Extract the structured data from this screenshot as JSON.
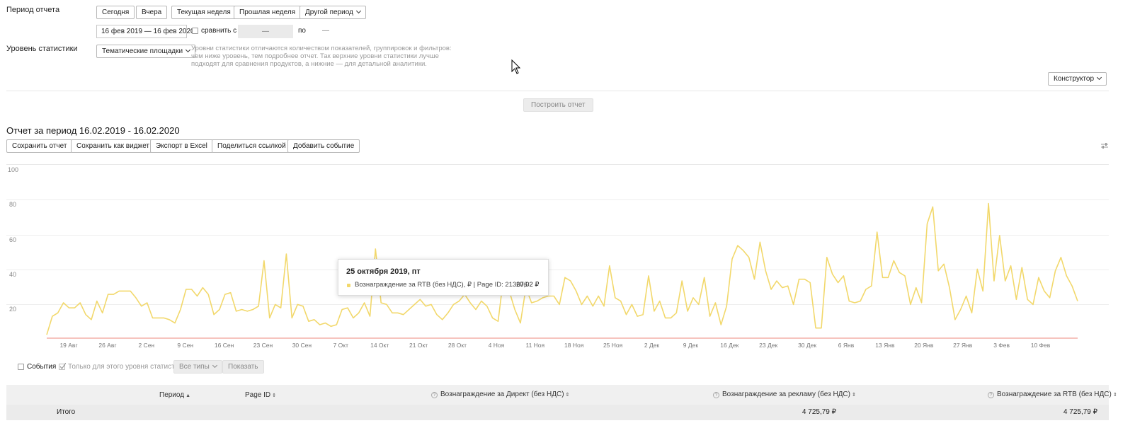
{
  "filters": {
    "period_label": "Период отчета",
    "quick_periods": [
      "Сегодня",
      "Вчера",
      "Текущая неделя",
      "Прошлая неделя",
      "Другой период"
    ],
    "date_range": "16 фев 2019 — 16 фев 2020",
    "compare_label": "сравнить с",
    "compare_from": "—",
    "compare_to_label": "по",
    "compare_to": "—",
    "level_label": "Уровень статистики",
    "level_value": "Тематические площадки",
    "level_hint": "Уровни статистики отличаются количеством показателей, группировок и фильтров: чем ниже уровень, тем подробнее отчет. Так верхние уровни статистики лучше подходят для сравнения продуктов, а нижние — для детальной аналитики.",
    "constructor_label": "Конструктор",
    "build_label": "Построить отчет"
  },
  "report": {
    "title": "Отчет за период 16.02.2019 - 16.02.2020",
    "actions": [
      "Сохранить отчет",
      "Сохранить как виджет",
      "Экспорт в Excel",
      "Поделиться ссылкой",
      "Добавить событие"
    ]
  },
  "tooltip": {
    "date": "25 октября 2019, пт",
    "series": "Вознаграждение за RTB (без НДС), ₽ | Page ID: 213676",
    "value": "20,02 ₽"
  },
  "events": {
    "events_label": "События",
    "only_level_label": "Только для этого уровня статистики",
    "all_types_label": "Все типы",
    "show_label": "Показать"
  },
  "table": {
    "headers": [
      "Период",
      "Page ID",
      "Вознаграждение за Директ (без НДС)",
      "Вознаграждение за рекламу (без НДС)",
      "Вознаграждение за RTB (без НДС)"
    ],
    "total_label": "Итого",
    "total_direct": "",
    "total_ads": "4 725,79 ₽",
    "total_rtb": "4 725,79 ₽"
  },
  "colors": {
    "series": "#f2d86b",
    "zero_line": "#f3b0a8",
    "accent": "#e0c050"
  },
  "chart_data": {
    "type": "line",
    "yticks": [
      "100",
      "80",
      "60",
      "40",
      "20"
    ],
    "ylim": [
      0,
      100
    ],
    "xticks": [
      "19 Авг",
      "26 Авг",
      "2 Сен",
      "9 Сен",
      "16 Сен",
      "23 Сен",
      "30 Сен",
      "7 Окт",
      "14 Окт",
      "21 Окт",
      "28 Окт",
      "4 Ноя",
      "11 Ноя",
      "18 Ноя",
      "25 Ноя",
      "2 Дек",
      "9 Дек",
      "16 Дек",
      "23 Дек",
      "30 Дек",
      "6 Янв",
      "13 Янв",
      "20 Янв",
      "27 Янв",
      "3 Фев",
      "10 Фев"
    ],
    "series": [
      {
        "name": "Вознаграждение за RTB (без НДС), ₽ | Page ID: 213676",
        "values": [
          2,
          13,
          15,
          21,
          18,
          18,
          21,
          14,
          11,
          22,
          15,
          26,
          26,
          28,
          28,
          28,
          24,
          19,
          21,
          12,
          12,
          12,
          11,
          9,
          17,
          29,
          29,
          25,
          30,
          26,
          14,
          17,
          26,
          27,
          16,
          17,
          16,
          17,
          19,
          46,
          12,
          20,
          18,
          50,
          12,
          20,
          19,
          10,
          11,
          8,
          9,
          7,
          8,
          17,
          18,
          12,
          15,
          21,
          13,
          53,
          21,
          20,
          15,
          15,
          14,
          17,
          20,
          23,
          19,
          20,
          14,
          11,
          15,
          20,
          22,
          26,
          21,
          17,
          22,
          19,
          12,
          10,
          37,
          28,
          17,
          9,
          30,
          21,
          22,
          24,
          25,
          25,
          20,
          36,
          34,
          28,
          20,
          25,
          19,
          25,
          19,
          43,
          24,
          22,
          14,
          20,
          13,
          14,
          37,
          16,
          22,
          12,
          12,
          15,
          34,
          16,
          24,
          20,
          36,
          13,
          21,
          8,
          19,
          47,
          55,
          52,
          48,
          35,
          57,
          40,
          29,
          34,
          30,
          31,
          20,
          35,
          35,
          33,
          6,
          6,
          48,
          38,
          33,
          37,
          22,
          21,
          22,
          29,
          31,
          63,
          36,
          36,
          46,
          39,
          37,
          20,
          30,
          21,
          68,
          78,
          40,
          44,
          30,
          11,
          17,
          25,
          15,
          41,
          28,
          80,
          34,
          61,
          34,
          43,
          23,
          42,
          23,
          20,
          36,
          28,
          24,
          40,
          48,
          37,
          31,
          22
        ]
      }
    ]
  }
}
